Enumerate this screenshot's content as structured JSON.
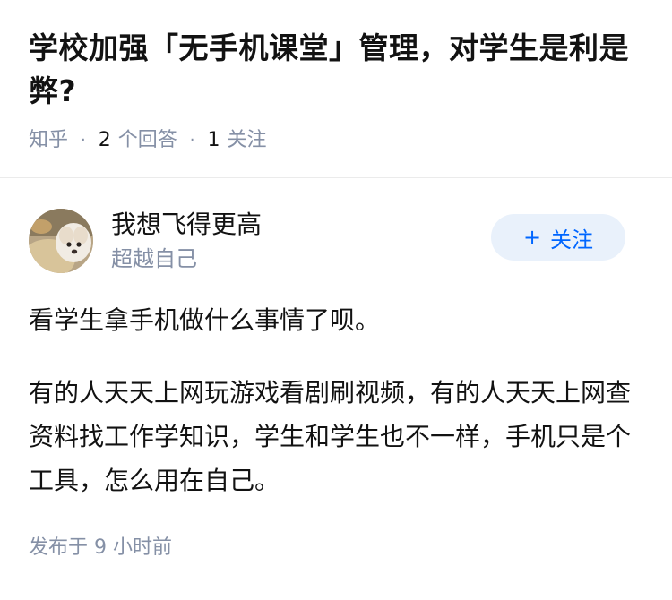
{
  "question": {
    "title": "学校加强「无手机课堂」管理，对学生是利是弊?",
    "source": "知乎",
    "answer_count": "2",
    "answer_label": "个回答",
    "follow_count": "1",
    "follow_label": "关注"
  },
  "answer": {
    "author": {
      "name": "我想飞得更高",
      "bio": "超越自己"
    },
    "follow_button": {
      "icon": "plus-icon",
      "label": "关注",
      "plus": "+"
    },
    "paragraphs": [
      "看学生拿手机做什么事情了呗。",
      "有的人天天上网玩游戏看剧刷视频，有的人天天上网查资料找工作学知识，学生和学生也不一样，手机只是个工具，怎么用在自己。"
    ],
    "publish_time": "发布于 9 小时前"
  },
  "colors": {
    "accent": "#0066ff",
    "follow_bg": "#e9f1fb",
    "meta_text": "#8590a6",
    "body_text": "#121212",
    "divider": "#ebebeb"
  }
}
